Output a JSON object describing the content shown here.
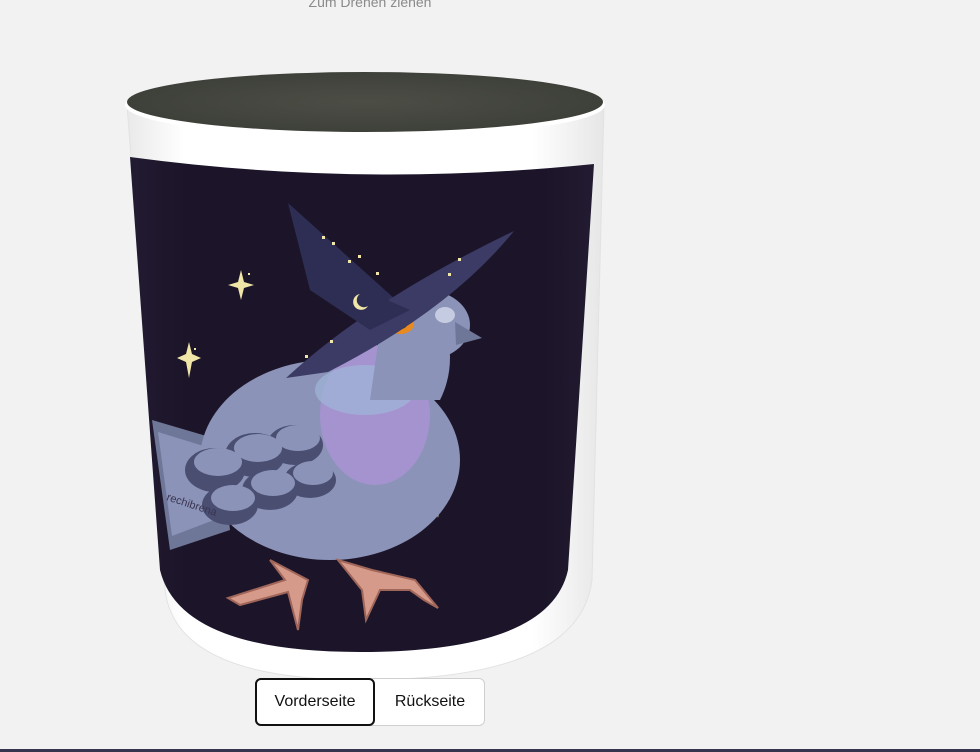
{
  "viewer": {
    "hint": "Zum Drehen ziehen",
    "product": "mug",
    "mug_interior_color": "#454740",
    "print_background_color": "#1c1529",
    "artwork": "pixel-art pigeon wearing a starry witch hat",
    "artist_signature": "rechibrena"
  },
  "side_toggle": {
    "front_label": "Vorderseite",
    "back_label": "Rückseite",
    "selected": "front"
  },
  "colors": {
    "page_background": "#f2f2f2",
    "bottom_rule": "#353550",
    "sparkle": "#efe6a8",
    "pigeon_body": "#8b93b8",
    "pigeon_breast": "#a593cf",
    "hat": "#2e2e55",
    "feet": "#d59a8a"
  }
}
